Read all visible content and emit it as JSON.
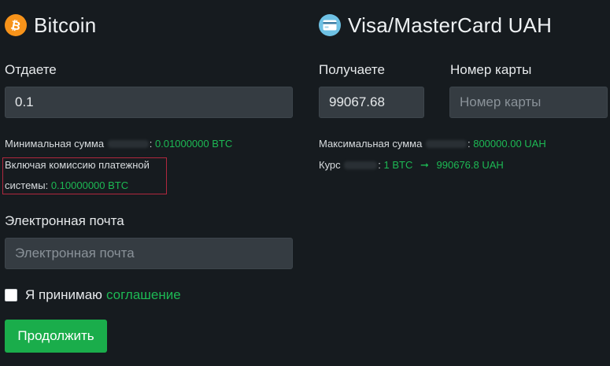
{
  "give": {
    "currency_name": "Bitcoin",
    "currency_icon": "bitcoin-icon",
    "icon_color": "#f7931a",
    "label": "Отдаете",
    "amount_value": "0.1",
    "min_label": "Минимальная сумма",
    "min_value": "0.01000000 BTC",
    "commission_line1": "Включая комиссию платежной",
    "commission_line2_label": "системы:",
    "commission_value": "0.10000000 BTC",
    "email_label": "Электронная почта",
    "email_placeholder": "Электронная почта"
  },
  "receive": {
    "currency_name": "Visa/MasterCard UAH",
    "currency_icon": "credit-card-icon",
    "icon_color": "#6ec1e4",
    "label": "Получаете",
    "amount_value": "99067.68",
    "card_label": "Номер карты",
    "card_placeholder": "Номер карты",
    "max_label": "Максимальная сумма",
    "max_value": "800000.00 UAH",
    "rate_label": "Курс",
    "rate_from": "1 BTC",
    "rate_to": "990676.8 UAH"
  },
  "agreement": {
    "text": "Я принимаю",
    "link_text": "соглашение",
    "checked": false
  },
  "actions": {
    "continue_label": "Продолжить"
  },
  "colors": {
    "background": "#161b1f",
    "accent_green": "#1db954",
    "button_green": "#1aad4b",
    "highlight_border": "#b0283e"
  }
}
